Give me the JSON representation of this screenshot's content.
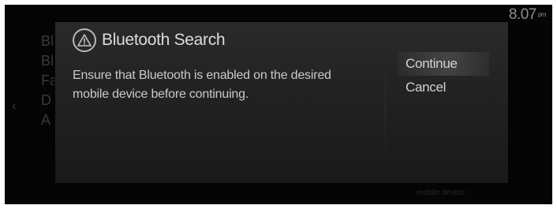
{
  "status_bar": {
    "time": "8.07",
    "ampm": "pm"
  },
  "background_menu": {
    "items": [
      {
        "label": "Bl"
      },
      {
        "label": "Bl"
      },
      {
        "label": "Fa"
      },
      {
        "label": "D"
      },
      {
        "label": "A"
      }
    ],
    "back_icon": "‹",
    "right_text": "ugh\n e\nmobile device"
  },
  "dialog": {
    "icon": "warning-icon",
    "title": "Bluetooth Search",
    "message": "Ensure that Bluetooth is enabled on the desired mobile device before continuing.",
    "options": [
      {
        "label": "Continue",
        "selected": true
      },
      {
        "label": "Cancel",
        "selected": false
      }
    ]
  },
  "colors": {
    "screen_background": "#050505",
    "dialog_background": "#222222",
    "text_primary": "#dcdcdc",
    "text_dim": "#3a3a3a"
  }
}
